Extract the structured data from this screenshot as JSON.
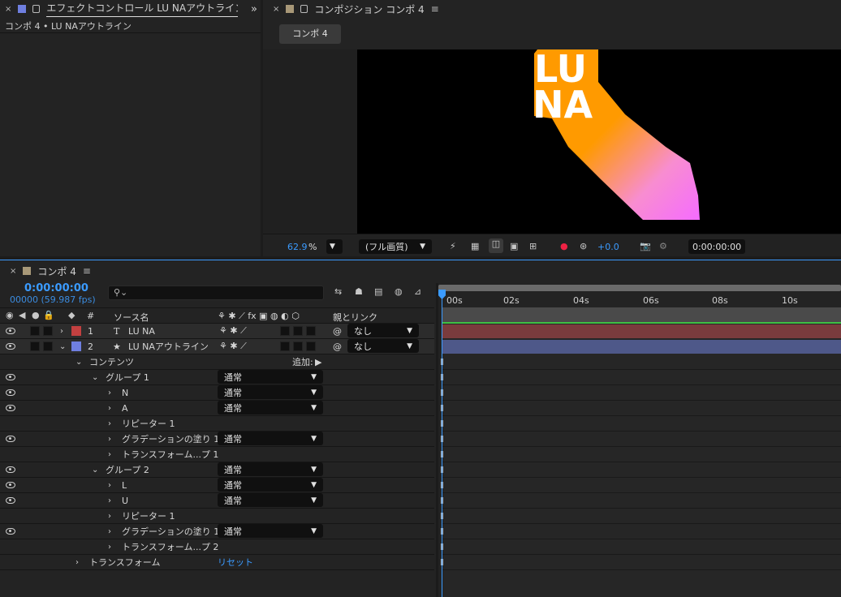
{
  "effect_panel": {
    "tab_title": "エフェクトコントロール LU NAアウトライン",
    "breadcrumb": "コンポ 4 • LU NAアウトライン"
  },
  "comp_panel": {
    "tab_title": "コンポジション コンポ 4",
    "comp_tab": "コンポ 4",
    "zoom": "62.9",
    "zoom_unit": "%",
    "resolution": "(フル画質)",
    "exposure": "+0.0",
    "timecode": "0:00:00:00",
    "artwork_text_line1": "LU",
    "artwork_text_line2": "NA"
  },
  "timeline": {
    "tab_title": "コンポ 4",
    "current_time": "0:00:00:00",
    "frame_info": "00000 (59.987 fps)",
    "search_placeholder": "",
    "header": {
      "num": "#",
      "source_name": "ソース名",
      "parent": "親とリンク"
    },
    "ruler_ticks": [
      "00s",
      "02s",
      "04s",
      "06s",
      "08s",
      "10s"
    ],
    "layers": [
      {
        "num": "1",
        "type_icon": "T",
        "name": "LU NA",
        "color": "#c24040",
        "parent": "なし",
        "bar_color": "#7a3b3d"
      },
      {
        "num": "2",
        "type_icon": "★",
        "name": "LU NAアウトライン",
        "color": "#6f7fe0",
        "parent": "なし",
        "bar_color": "#4e5889"
      }
    ],
    "contents_label": "コンテンツ",
    "add_label": "追加:",
    "groups": [
      {
        "name": "グループ 1",
        "mode": "通常",
        "items": [
          {
            "name": "N",
            "mode": "通常"
          },
          {
            "name": "A",
            "mode": "通常"
          },
          {
            "name": "リピーター 1",
            "mode": ""
          },
          {
            "name": "グラデーションの塗り 1",
            "mode": "通常"
          },
          {
            "name": "トランスフォーム...プ 1",
            "mode": ""
          }
        ]
      },
      {
        "name": "グループ 2",
        "mode": "通常",
        "items": [
          {
            "name": "L",
            "mode": "通常"
          },
          {
            "name": "U",
            "mode": "通常"
          },
          {
            "name": "リピーター 1",
            "mode": ""
          },
          {
            "name": "グラデーションの塗り 1",
            "mode": "通常"
          },
          {
            "name": "トランスフォーム...プ 2",
            "mode": ""
          }
        ]
      }
    ],
    "transform_label": "トランスフォーム",
    "reset_label": "リセット"
  },
  "colors": {
    "accent_blue": "#3b9bff",
    "orange": "#ff9a00",
    "pink": "#f56bff",
    "work_area_green": "#3fc043"
  }
}
